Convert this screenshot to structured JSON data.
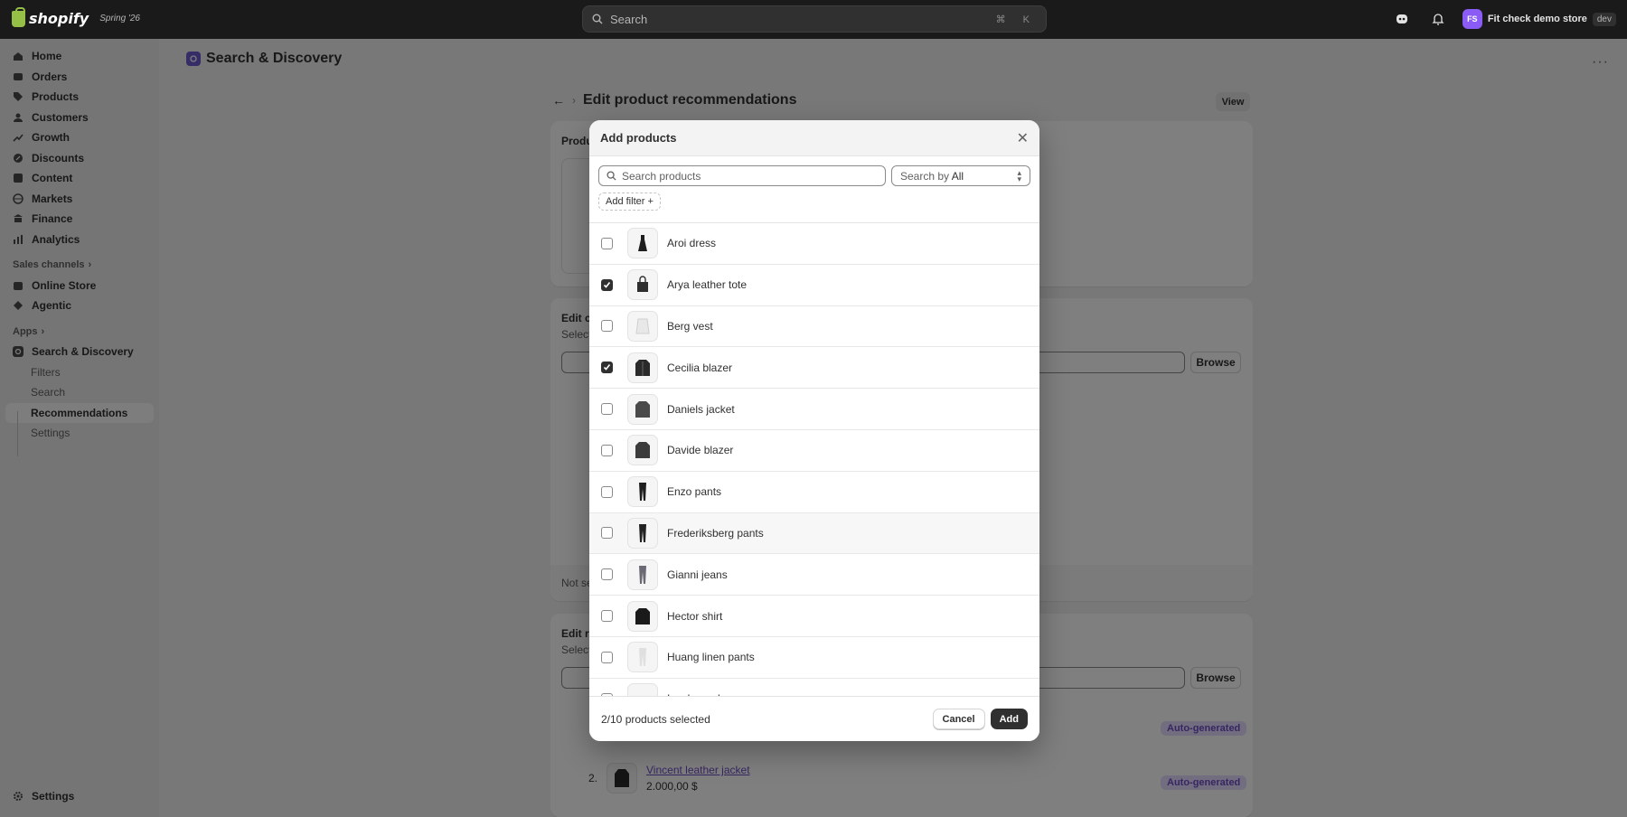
{
  "topbar": {
    "brand": "shopify",
    "tag": "Spring '26",
    "search_placeholder": "Search",
    "shortcut": "⌘ K",
    "avatar": "FS",
    "store": "Fit check demo store",
    "env": "dev"
  },
  "sidebar": {
    "items": [
      {
        "label": "Home",
        "icon": "home-icon"
      },
      {
        "label": "Orders",
        "icon": "orders-icon"
      },
      {
        "label": "Products",
        "icon": "tag-icon"
      },
      {
        "label": "Customers",
        "icon": "person-icon"
      },
      {
        "label": "Growth",
        "icon": "growth-icon"
      },
      {
        "label": "Discounts",
        "icon": "discount-icon"
      },
      {
        "label": "Content",
        "icon": "content-icon"
      },
      {
        "label": "Markets",
        "icon": "globe-icon"
      },
      {
        "label": "Finance",
        "icon": "bank-icon"
      },
      {
        "label": "Analytics",
        "icon": "chart-icon"
      }
    ],
    "sales_channels": "Sales channels",
    "channels": [
      {
        "label": "Online Store",
        "icon": "store-icon"
      },
      {
        "label": "Agentic",
        "icon": "agent-icon"
      }
    ],
    "apps": "Apps",
    "app": "Search & Discovery",
    "app_sub": [
      "Filters",
      "Search",
      "Recommendations",
      "Settings"
    ],
    "settings": "Settings"
  },
  "page": {
    "title": "Search & Discovery",
    "edit_title": "Edit product recommendations",
    "view": "View",
    "card1_heading": "Produ",
    "card2_heading": "Edit c",
    "card2_sub": "Select",
    "browse": "Browse",
    "not_selected": "Not se",
    "card3_heading": "Edit re",
    "card3_sub": "Select",
    "recs": [
      {
        "index": "2.",
        "name": "Vincent leather jacket",
        "price": "2.000,00 $",
        "badge": "Auto-generated"
      }
    ],
    "badge_top": "Auto-generated"
  },
  "modal": {
    "title": "Add products",
    "search_placeholder": "Search products",
    "search_by_label": "Search by",
    "search_by_value": "All",
    "add_filter": "Add filter +",
    "products": [
      {
        "name": "Aroi dress",
        "checked": false
      },
      {
        "name": "Arya leather tote",
        "checked": true
      },
      {
        "name": "Berg vest",
        "checked": false
      },
      {
        "name": "Cecilia blazer",
        "checked": true
      },
      {
        "name": "Daniels jacket",
        "checked": false
      },
      {
        "name": "Davide blazer",
        "checked": false
      },
      {
        "name": "Enzo pants",
        "checked": false
      },
      {
        "name": "Frederiksberg pants",
        "checked": false
      },
      {
        "name": "Gianni jeans",
        "checked": false
      },
      {
        "name": "Hector shirt",
        "checked": false
      },
      {
        "name": "Huang linen pants",
        "checked": false
      },
      {
        "name": "Isenberg shoes",
        "checked": false
      }
    ],
    "selected_count": "2/10 products selected",
    "cancel": "Cancel",
    "add": "Add"
  }
}
